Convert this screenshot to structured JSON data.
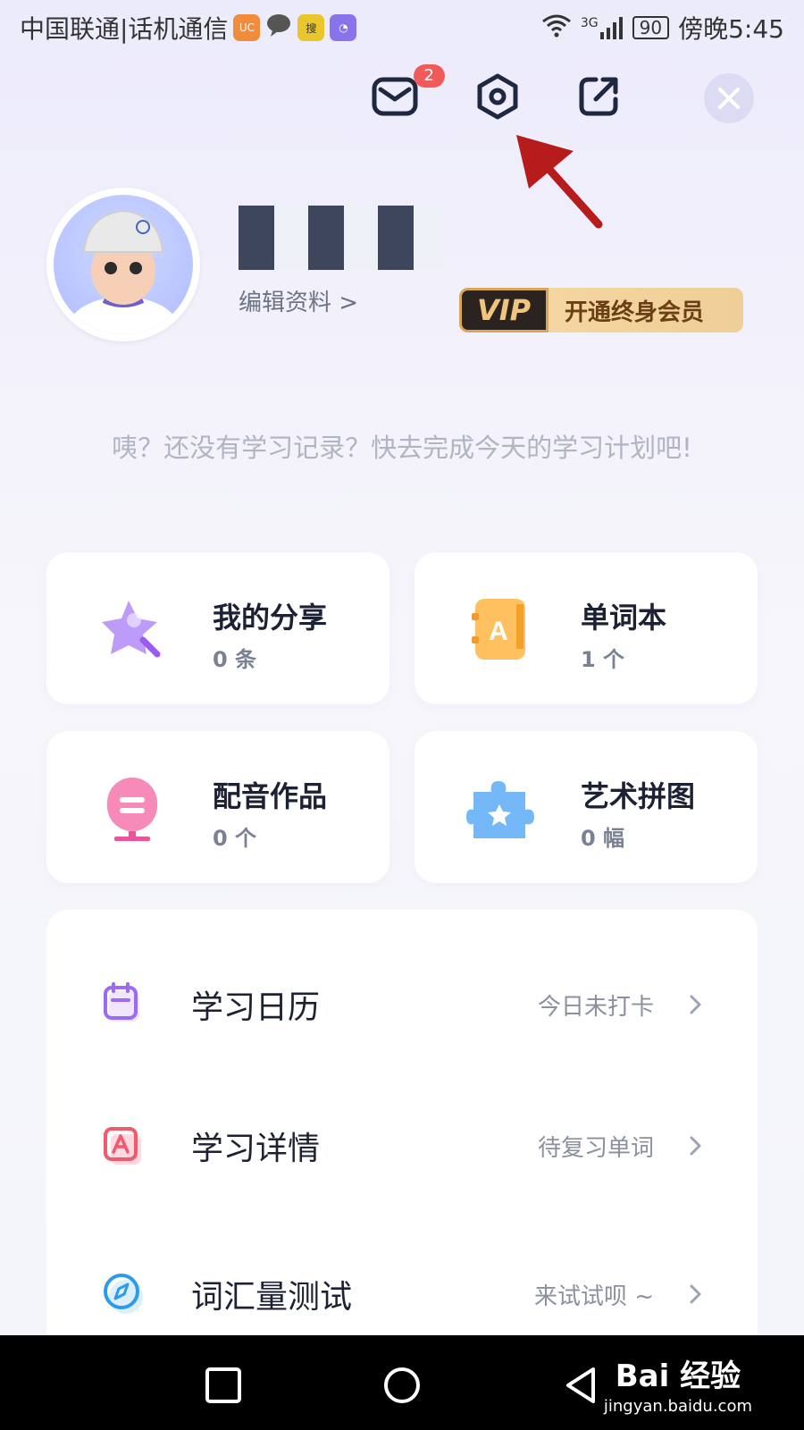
{
  "status_bar": {
    "carrier": "中国联通|话机通信",
    "network": "3G",
    "battery": "90",
    "time": "傍晚5:45",
    "apps": [
      {
        "name": "uc-browser-icon",
        "color": "#f08c3a"
      },
      {
        "name": "chat-bubble-icon",
        "color": "#555555"
      },
      {
        "name": "sogou-icon",
        "color": "#e8c62c"
      },
      {
        "name": "stats-app-icon",
        "color": "#8a72e8"
      }
    ]
  },
  "header": {
    "message_badge": "2"
  },
  "profile": {
    "edit_label": "编辑资料 >",
    "vip_tag": "VIP",
    "vip_cta": "开通终身会员"
  },
  "hint": "咦？还没有学习记录？快去完成今天的学习计划吧!",
  "cards": [
    {
      "title": "我的分享",
      "count": "0 条",
      "icon": "star-wand-icon",
      "color": "#b083f5"
    },
    {
      "title": "单词本",
      "count": "1 个",
      "icon": "word-book-icon",
      "color": "#ffb44a"
    },
    {
      "title": "配音作品",
      "count": "0 个",
      "icon": "microphone-icon",
      "color": "#f46aa6"
    },
    {
      "title": "艺术拼图",
      "count": "0 幅",
      "icon": "puzzle-icon",
      "color": "#55a9f6"
    }
  ],
  "list": [
    {
      "label": "学习日历",
      "status": "今日未打卡",
      "icon": "calendar-icon",
      "color": "#9d6bf2"
    },
    {
      "label": "学习详情",
      "status": "待复习单词",
      "icon": "study-detail-icon",
      "color": "#f0596e"
    },
    {
      "label": "词汇量测试",
      "status": "来试试呗 ~",
      "icon": "compass-icon",
      "color": "#2c9be8"
    }
  ],
  "watermark": {
    "main": "Bai 经验",
    "sub": "jingyan.baidu.com"
  }
}
